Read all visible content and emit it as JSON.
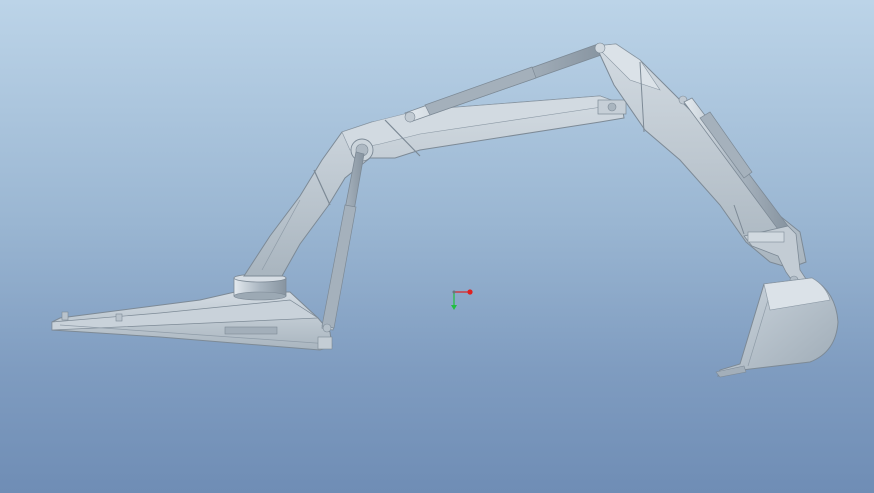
{
  "viewport": {
    "background_top": "#bcd4e8",
    "background_bottom": "#6f8db5"
  },
  "model": {
    "part_color": "#b7c2cc",
    "edge_color": "#7d8a96",
    "shade_color": "#9aa7b3",
    "highlight_color": "#dfe6ec"
  },
  "axis_triad": {
    "x_color": "#e02020",
    "y_color": "#20c040",
    "origin_color": "#6a7480"
  }
}
